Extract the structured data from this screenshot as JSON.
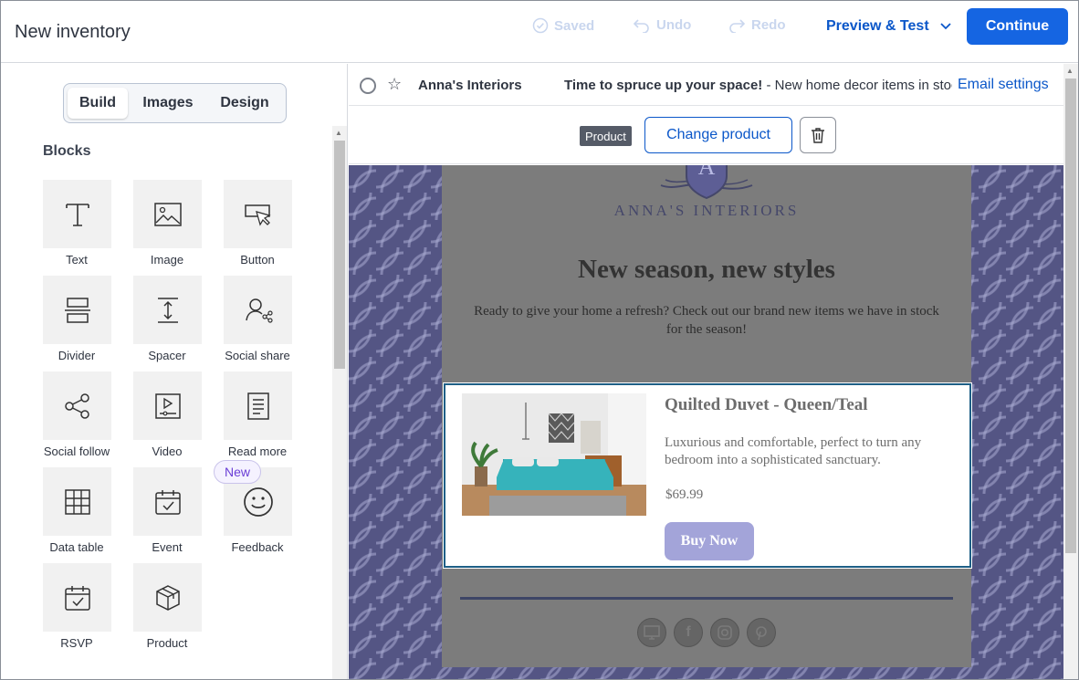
{
  "header": {
    "title": "New inventory",
    "saved": "Saved",
    "undo": "Undo",
    "redo": "Redo",
    "preview": "Preview & Test",
    "continue": "Continue"
  },
  "sidebar": {
    "tabs": [
      "Build",
      "Images",
      "Design"
    ],
    "active_tab": "Build",
    "blocks_title": "Blocks",
    "new_badge": "New",
    "blocks": [
      {
        "label": "Text",
        "icon": "text-icon"
      },
      {
        "label": "Image",
        "icon": "image-icon"
      },
      {
        "label": "Button",
        "icon": "button-icon"
      },
      {
        "label": "Divider",
        "icon": "divider-icon"
      },
      {
        "label": "Spacer",
        "icon": "spacer-icon"
      },
      {
        "label": "Social share",
        "icon": "social-share-icon"
      },
      {
        "label": "Social follow",
        "icon": "social-follow-icon"
      },
      {
        "label": "Video",
        "icon": "video-icon"
      },
      {
        "label": "Read more",
        "icon": "read-more-icon"
      },
      {
        "label": "Data table",
        "icon": "data-table-icon"
      },
      {
        "label": "Event",
        "icon": "event-icon"
      },
      {
        "label": "Feedback",
        "icon": "feedback-icon"
      },
      {
        "label": "RSVP",
        "icon": "rsvp-icon"
      },
      {
        "label": "Product",
        "icon": "product-icon"
      }
    ]
  },
  "email_bar": {
    "from": "Anna's Interiors",
    "subject": "Time to spruce up your space!",
    "preheader": " - New home decor items in stock",
    "settings": "Email settings"
  },
  "toolbar": {
    "tag": "Product",
    "change": "Change product"
  },
  "email": {
    "brand": "ANNA'S INTERIORS",
    "logo_letter": "A",
    "headline": "New season, new styles",
    "intro": "Ready to give your home a refresh? Check out our brand new items we have in stock for the season!",
    "product": {
      "name": "Quilted Duvet - Queen/Teal",
      "description": "Luxurious and comfortable, perfect to turn any bedroom into a sophisticated sanctuary.",
      "price": "$69.99",
      "button": "Buy Now"
    },
    "socials": [
      "website-icon",
      "facebook-icon",
      "instagram-icon",
      "pinterest-icon"
    ]
  }
}
